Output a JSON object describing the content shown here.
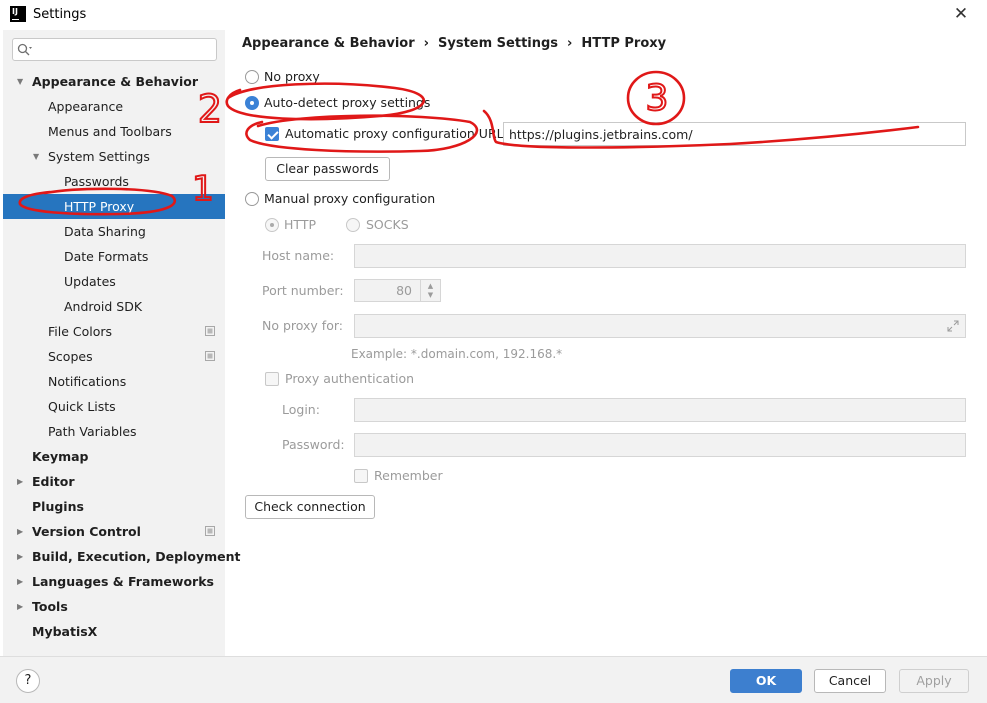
{
  "window": {
    "title": "Settings",
    "close_glyph": "✕"
  },
  "search": {
    "placeholder": "",
    "value": ""
  },
  "tree": [
    {
      "label": "Appearance & Behavior",
      "bold": true,
      "indent": 0,
      "arrow": "down"
    },
    {
      "label": "Appearance",
      "indent": 1
    },
    {
      "label": "Menus and Toolbars",
      "indent": 1
    },
    {
      "label": "System Settings",
      "indent": 1,
      "arrow": "down"
    },
    {
      "label": "Passwords",
      "indent": 2
    },
    {
      "label": "HTTP Proxy",
      "indent": 2,
      "selected": true
    },
    {
      "label": "Data Sharing",
      "indent": 2
    },
    {
      "label": "Date Formats",
      "indent": 2
    },
    {
      "label": "Updates",
      "indent": 2
    },
    {
      "label": "Android SDK",
      "indent": 2
    },
    {
      "label": "File Colors",
      "indent": 1,
      "project_icon": true
    },
    {
      "label": "Scopes",
      "indent": 1,
      "project_icon": true
    },
    {
      "label": "Notifications",
      "indent": 1
    },
    {
      "label": "Quick Lists",
      "indent": 1
    },
    {
      "label": "Path Variables",
      "indent": 1
    },
    {
      "label": "Keymap",
      "bold": true,
      "indent": 0
    },
    {
      "label": "Editor",
      "bold": true,
      "indent": 0,
      "arrow": "right"
    },
    {
      "label": "Plugins",
      "bold": true,
      "indent": 0
    },
    {
      "label": "Version Control",
      "bold": true,
      "indent": 0,
      "arrow": "right",
      "project_icon": true
    },
    {
      "label": "Build, Execution, Deployment",
      "bold": true,
      "indent": 0,
      "arrow": "right"
    },
    {
      "label": "Languages & Frameworks",
      "bold": true,
      "indent": 0,
      "arrow": "right"
    },
    {
      "label": "Tools",
      "bold": true,
      "indent": 0,
      "arrow": "right"
    },
    {
      "label": "MybatisX",
      "bold": true,
      "indent": 0
    }
  ],
  "breadcrumb": {
    "parts": [
      "Appearance & Behavior",
      "System Settings",
      "HTTP Proxy"
    ],
    "separator": "›"
  },
  "proxy": {
    "no_proxy_label": "No proxy",
    "auto_detect_label": "Auto-detect proxy settings",
    "auto_config_url_label": "Automatic proxy configuration URL:",
    "auto_config_url_value": "https://plugins.jetbrains.com/",
    "clear_passwords_label": "Clear passwords",
    "manual_label": "Manual proxy configuration",
    "http_label": "HTTP",
    "socks_label": "SOCKS",
    "host_name_label": "Host name:",
    "port_number_label": "Port number:",
    "port_value": "80",
    "no_proxy_for_label": "No proxy for:",
    "example_text": "Example: *.domain.com, 192.168.*",
    "proxy_auth_label": "Proxy authentication",
    "login_label": "Login:",
    "password_label": "Password:",
    "remember_label": "Remember",
    "check_connection_label": "Check connection",
    "selected_mode": "auto-detect",
    "auto_config_checked": true
  },
  "footer": {
    "help": "?",
    "ok": "OK",
    "cancel": "Cancel",
    "apply": "Apply"
  },
  "annotations": {
    "labels": [
      "1",
      "2",
      "3"
    ],
    "color": "#e01818"
  },
  "colors": {
    "accent": "#2675bf",
    "sidebar_bg": "#f2f2f2"
  }
}
